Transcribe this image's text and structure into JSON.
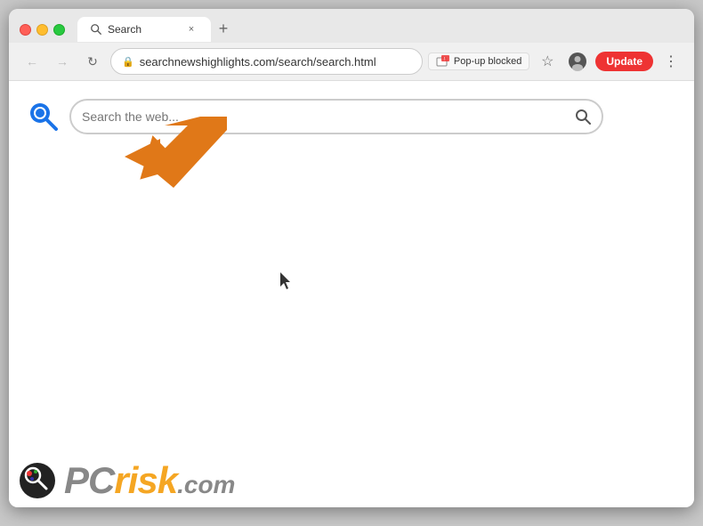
{
  "browser": {
    "title": "Search",
    "tab": {
      "title": "Search",
      "close_label": "×"
    },
    "new_tab_label": "+",
    "nav": {
      "back_label": "←",
      "forward_label": "→",
      "reload_label": "↻"
    },
    "address_bar": {
      "url": "searchnewshighlights.com/search/search.html",
      "lock_symbol": "🔒"
    },
    "popup_blocked_label": "Pop-up blocked",
    "star_symbol": "☆",
    "account_symbol": "👤",
    "update_label": "Update",
    "menu_symbol": "⋮"
  },
  "page": {
    "search_placeholder": "Search the web...",
    "search_submit_symbol": "🔍"
  },
  "watermark": {
    "pc_text": "PC",
    "risk_text": "risk",
    "com_text": ".com"
  }
}
